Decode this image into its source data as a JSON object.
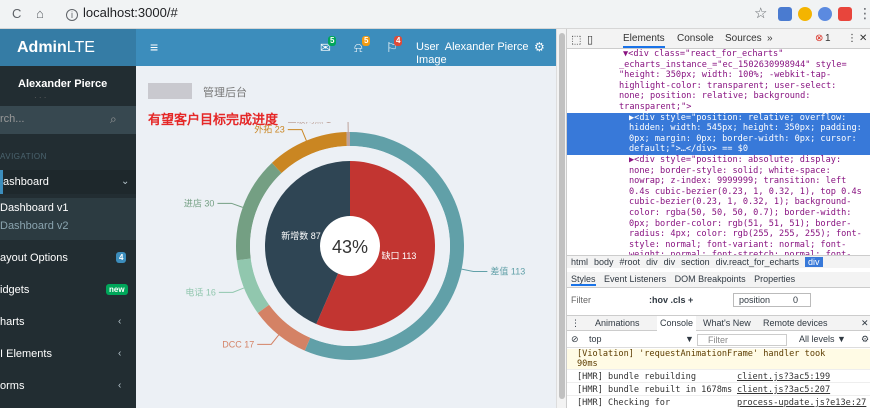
{
  "browser": {
    "url": "localhost:3000/#",
    "nav": {
      "back": "←",
      "forward": "→",
      "reload": "C",
      "home": "⌂"
    },
    "star": "☆",
    "menu": "⋮"
  },
  "header": {
    "logo_bold": "Admin",
    "logo_light": "LTE",
    "toggle_icon": "≡",
    "notifications": [
      {
        "icon": "envelope-icon",
        "glyph": "✉",
        "count": "5",
        "color": "#00a65a"
      },
      {
        "icon": "bell-icon",
        "glyph": "⍾",
        "count": "5",
        "color": "#f39c12"
      },
      {
        "icon": "flag-icon",
        "glyph": "⚐",
        "count": "4",
        "color": "#dd4b39"
      }
    ],
    "user_line1": "User",
    "user_name": "Alexander Pierce",
    "user_line2": "Image",
    "gear_icon": "⚙"
  },
  "sidebar": {
    "user_name": "Alexander Pierce",
    "search_placeholder": "rch...",
    "search_icon": "⌕",
    "nav_header": "AVIGATION",
    "items": [
      {
        "label": "ashboard",
        "chevron": "⌄"
      },
      {
        "label": "ayout Options",
        "tag": "4",
        "tag_color": "#3c8dbc"
      },
      {
        "label": "idgets",
        "tag": "new",
        "tag_color": "#00a65a"
      },
      {
        "label": "harts",
        "chevron": "‹"
      },
      {
        "label": "I Elements",
        "chevron": "‹"
      },
      {
        "label": "orms",
        "chevron": "‹"
      }
    ],
    "submenu": [
      "Dashboard v1",
      "Dashboard v2"
    ]
  },
  "content": {
    "subtitle": "管理后台",
    "chart_title": "有望客户目标完成进度"
  },
  "chart_data": {
    "type": "pie",
    "title": "有望客户目标完成进度",
    "center_label": "43%",
    "inner_series": {
      "name": "完成进度",
      "slices": [
        {
          "label": "缺口 113",
          "name": "缺口",
          "value": 113,
          "color": "#c23531"
        },
        {
          "label": "新增数 87",
          "name": "新增数",
          "value": 87,
          "color": "#2f4554"
        }
      ]
    },
    "outer_series": {
      "name": "来源",
      "slices": [
        {
          "label": "差值 113",
          "name": "差值",
          "value": 113,
          "color": "#61a0a8"
        },
        {
          "label": "DCC 17",
          "name": "DCC",
          "value": 17,
          "color": "#d48265"
        },
        {
          "label": "电话 16",
          "name": "电话",
          "value": 16,
          "color": "#91c7ae"
        },
        {
          "label": "进店 30",
          "name": "进店",
          "value": 30,
          "color": "#749f83"
        },
        {
          "label": "外拓 23",
          "name": "外拓",
          "value": 23,
          "color": "#ca8622"
        },
        {
          "label": "二级网点 1",
          "name": "二级网点",
          "value": 1,
          "color": "#bda29a"
        }
      ]
    }
  },
  "devtools": {
    "tabs": [
      "Elements",
      "Console",
      "Sources",
      "»"
    ],
    "error_count": "1",
    "code_lines": [
      "▼<div class=\"react_for_echarts\"",
      "_echarts_instance_=\"ec_1502630998944\" style=",
      "\"height: 350px; width: 100%; -webkit-tap-",
      "highlight-color: transparent; user-select:",
      "none; position: relative; background:",
      "transparent;\">",
      "▶<div style=\"position: relative; overflow:",
      "hidden; width: 545px; height: 350px; padding:",
      "0px; margin: 0px; border-width: 0px; cursor:",
      "default;\">…</div> == $0",
      "▶<div style=\"position: absolute; display:",
      "none; border-style: solid; white-space:",
      "nowrap; z-index: 9999999; transition: left",
      "0.4s cubic-bezier(0.23, 1, 0.32, 1), top 0.4s",
      "cubic-bezier(0.23, 1, 0.32, 1); background-",
      "color: rgba(50, 50, 50, 0.7); border-width:",
      "0px; border-color: rgb(51, 51, 51); border-",
      "radius: 4px; color: rgb(255, 255, 255); font-",
      "style: normal; font-variant: normal; font-",
      "weight: normal; font-stretch: normal; font-"
    ],
    "breadcrumbs": [
      "html",
      "body",
      "#root",
      "div",
      "div",
      "section",
      "div.react_for_echarts",
      "div"
    ],
    "style_tabs": [
      "Styles",
      "Event Listeners",
      "DOM Breakpoints",
      "Properties"
    ],
    "filter_label": "Filter",
    "filter_hov": ":hov .cls +",
    "position_label": "position",
    "position_value": "0",
    "console_tabs": [
      "Animations",
      "Console",
      "What's New",
      "Remote devices"
    ],
    "context": "top",
    "filter_placeholder": "Filter",
    "levels": "All levels ▼",
    "logs": [
      {
        "text": "[Violation] 'requestAnimationFrame' handler took",
        "text2": "90ms",
        "src": "",
        "warn": true
      },
      {
        "text": "[HMR] bundle rebuilding",
        "src": "client.js?3ac5:199",
        "warn": false
      },
      {
        "text": "[HMR] bundle rebuilt in 1678ms",
        "src": "client.js?3ac5:207",
        "warn": false
      },
      {
        "text": "[HMR] Checking for",
        "src": "process-update.js?e13e:27",
        "warn": false
      }
    ]
  }
}
